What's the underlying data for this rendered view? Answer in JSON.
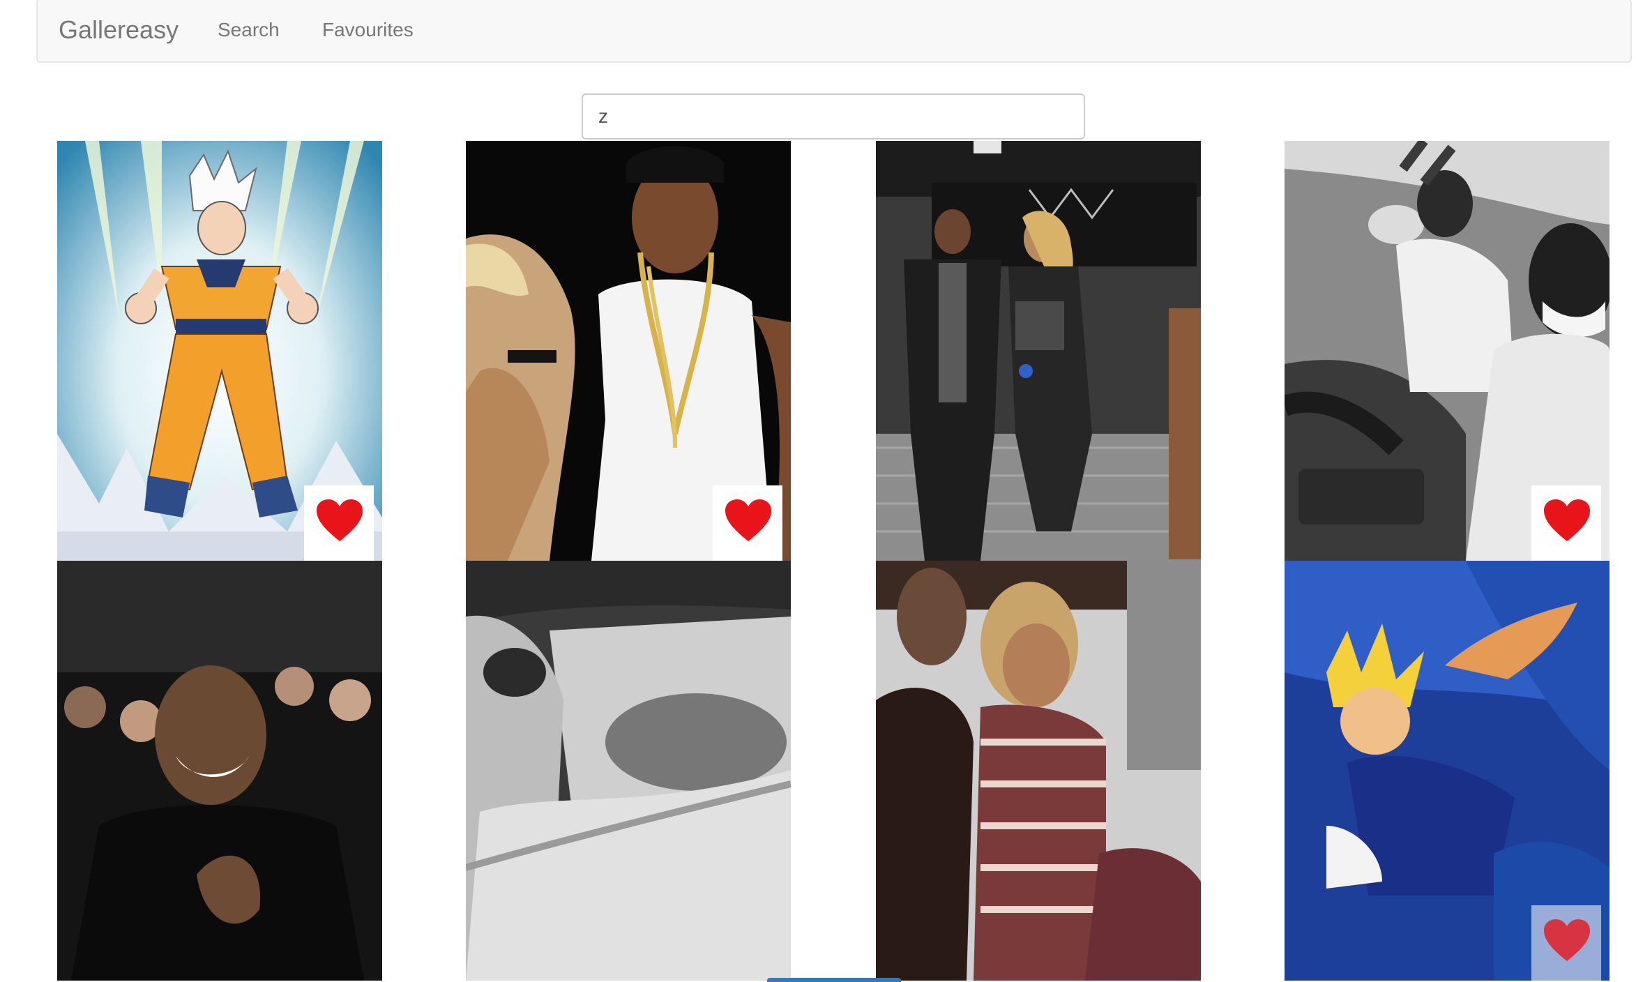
{
  "navbar": {
    "brand": "Gallereasy",
    "links": [
      {
        "label": "Search"
      },
      {
        "label": "Favourites"
      }
    ]
  },
  "search": {
    "value": "z"
  },
  "gallery": {
    "items": [
      {
        "subject": "anime warrior powering up",
        "favourite_icon": "heart-icon",
        "favourite_visible": true
      },
      {
        "subject": "man in gold chain and woman",
        "favourite_icon": "heart-icon",
        "favourite_visible": true
      },
      {
        "subject": "couple backstage at arena",
        "favourite_icon": "heart-icon",
        "favourite_visible": false
      },
      {
        "subject": "laughing men in car, black and white",
        "favourite_icon": "heart-icon",
        "favourite_visible": true
      },
      {
        "subject": "smiling man clapping in audience",
        "favourite_icon": "heart-icon",
        "favourite_visible": false
      },
      {
        "subject": "black and white driving scene",
        "favourite_icon": "heart-icon",
        "favourite_visible": false
      },
      {
        "subject": "woman courtside with blonde bangs",
        "favourite_icon": "heart-icon",
        "favourite_visible": false
      },
      {
        "subject": "pixel-art fighter leaping",
        "favourite_icon": "heart-icon",
        "favourite_visible": true,
        "faded": true
      }
    ]
  },
  "colors": {
    "heart": "#e8141a",
    "navbar_bg": "#f8f8f8",
    "link": "#777777",
    "accent": "#337ab7"
  }
}
